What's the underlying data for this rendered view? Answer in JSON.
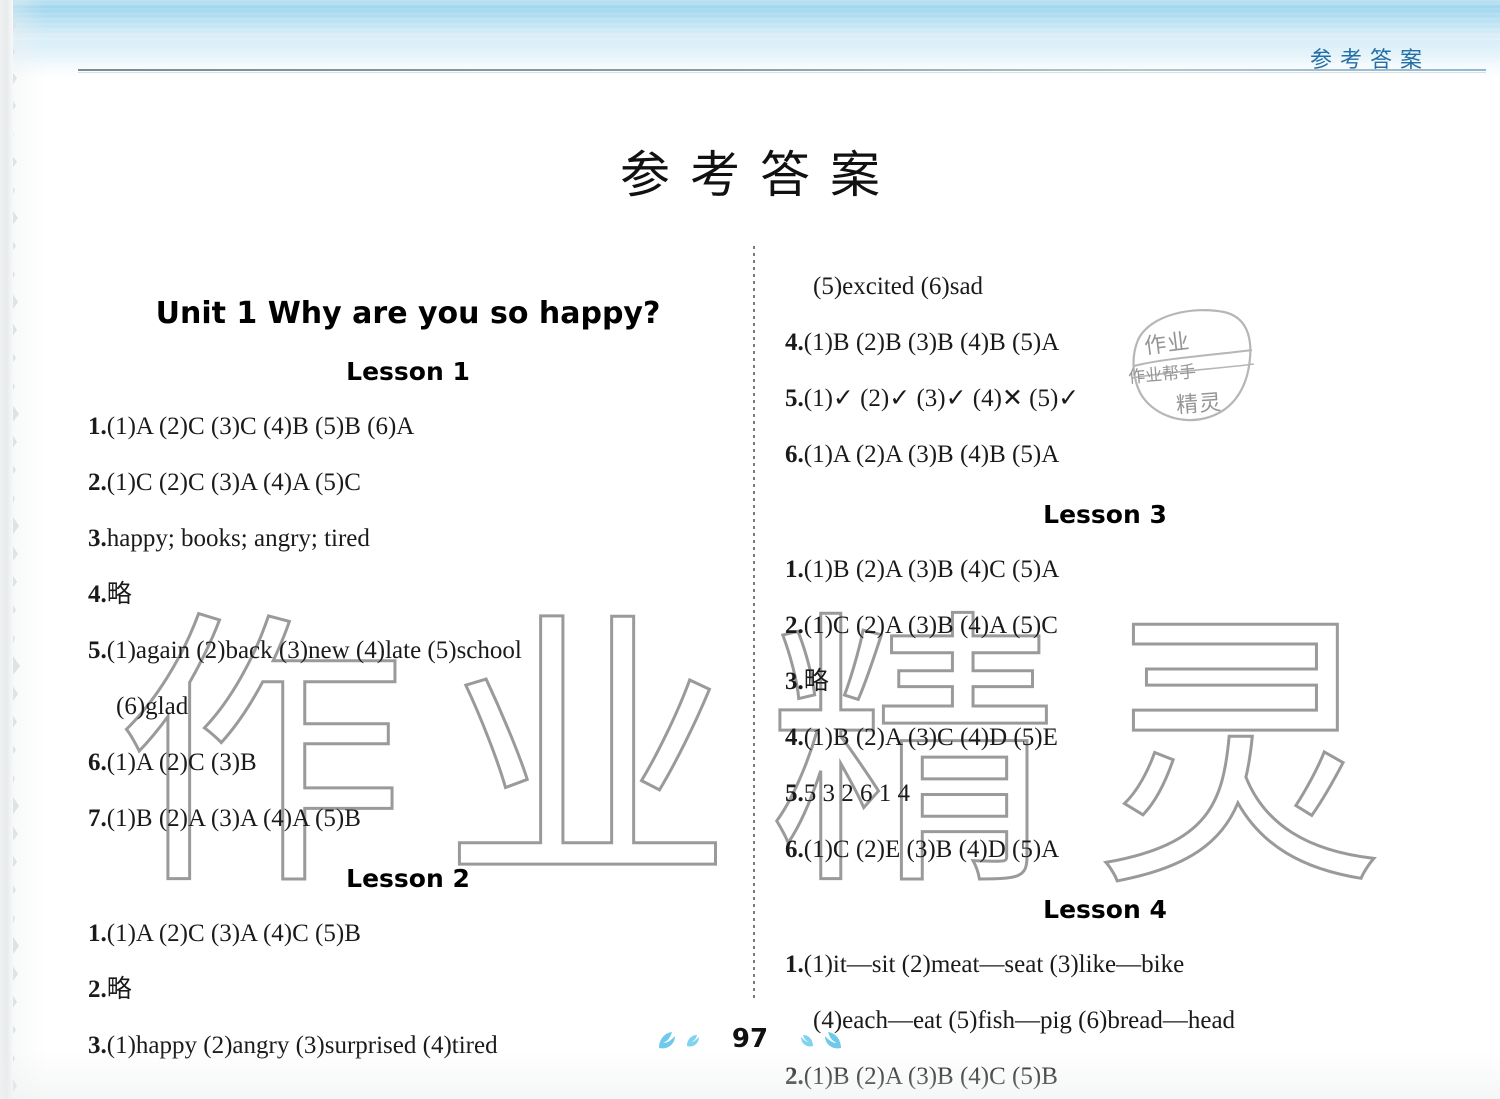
{
  "header": {
    "running_head": "参考答案",
    "accent_color": "#246ea8"
  },
  "page_title": "参考答案",
  "watermark": {
    "text": "作业精灵",
    "stroke_color": "#9a9a9a"
  },
  "seal_stamp": {
    "line1": "作业",
    "line2": "作业帮手",
    "line3": "精灵"
  },
  "footer": {
    "page_number": "97"
  },
  "columns": {
    "left": {
      "unit_heading": "Unit 1    Why are you so happy?",
      "sections": [
        {
          "lesson": "Lesson 1",
          "items": [
            {
              "num": "1.",
              "body": "(1)A  (2)C  (3)C  (4)B  (5)B  (6)A"
            },
            {
              "num": "2.",
              "body": "(1)C  (2)C  (3)A  (4)A  (5)C"
            },
            {
              "num": "3.",
              "body": "happy; books; angry; tired"
            },
            {
              "num": "4.",
              "body": "略"
            },
            {
              "num": "5.",
              "body": "(1)again  (2)back  (3)new  (4)late  (5)school"
            },
            {
              "num": "",
              "body": "(6)glad",
              "continuation": true
            },
            {
              "num": "6.",
              "body": "(1)A  (2)C  (3)B"
            },
            {
              "num": "7.",
              "body": "(1)B  (2)A  (3)A  (4)A  (5)B"
            }
          ]
        },
        {
          "lesson": "Lesson 2",
          "items": [
            {
              "num": "1.",
              "body": "(1)A  (2)C  (3)A  (4)C  (5)B"
            },
            {
              "num": "2.",
              "body": "略"
            },
            {
              "num": "3.",
              "body": "(1)happy  (2)angry  (3)surprised  (4)tired"
            }
          ]
        }
      ]
    },
    "right": {
      "sections": [
        {
          "lesson": "",
          "items": [
            {
              "num": "",
              "body": "(5)excited  (6)sad",
              "continuation": true
            },
            {
              "num": "4.",
              "body": "(1)B  (2)B  (3)B  (4)B  (5)A"
            },
            {
              "num": "5.",
              "body": "(1)✓   (2)✓   (3)✓   (4)✕   (5)✓"
            },
            {
              "num": "6.",
              "body": "(1)A  (2)A  (3)B  (4)B  (5)A"
            }
          ]
        },
        {
          "lesson": "Lesson 3",
          "items": [
            {
              "num": "1.",
              "body": "(1)B  (2)A  (3)B  (4)C  (5)A"
            },
            {
              "num": "2.",
              "body": "(1)C  (2)A  (3)B  (4)A  (5)C"
            },
            {
              "num": "3.",
              "body": "略"
            },
            {
              "num": "4.",
              "body": "(1)B  (2)A  (3)C  (4)D  (5)E"
            },
            {
              "num": "5.",
              "body": "5  3  2  6  1  4"
            },
            {
              "num": "6.",
              "body": "(1)C  (2)E  (3)B  (4)D  (5)A"
            }
          ]
        },
        {
          "lesson": "Lesson 4",
          "items": [
            {
              "num": "1.",
              "body": "(1)it—sit   (2)meat—seat   (3)like—bike"
            },
            {
              "num": "",
              "body": "(4)each—eat  (5)fish—pig  (6)bread—head",
              "continuation": true
            },
            {
              "num": "2.",
              "body": "(1)B  (2)A  (3)B  (4)C  (5)B"
            }
          ]
        }
      ]
    }
  }
}
